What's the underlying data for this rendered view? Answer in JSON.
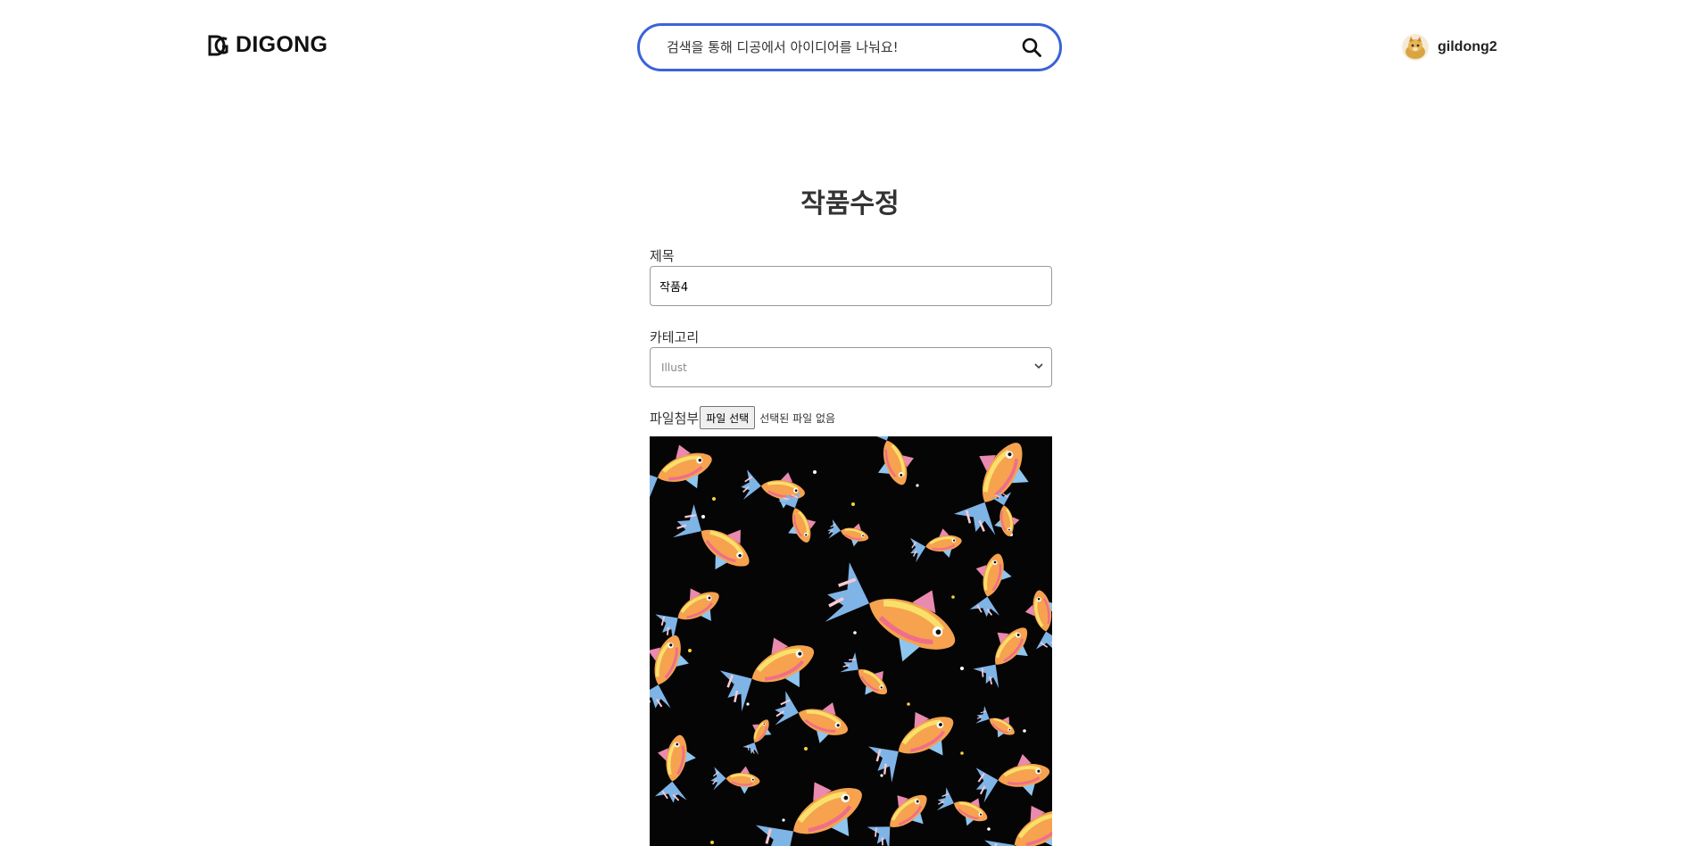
{
  "header": {
    "logo_text": "DIGONG",
    "search": {
      "placeholder": "검색을 통해 디공에서 아이디어를 나눠요!"
    },
    "user": {
      "name": "gildong2"
    }
  },
  "page": {
    "title": "작품수정"
  },
  "form": {
    "title_label": "제목",
    "title_value": "작품4",
    "category_label": "카테고리",
    "category_value": "Illust",
    "file_label": "파일첨부",
    "file_button": "파일 선택",
    "file_status": "선택된 파일 없음"
  },
  "colors": {
    "accent": "#3a63d8",
    "preview_background": "#050505"
  }
}
